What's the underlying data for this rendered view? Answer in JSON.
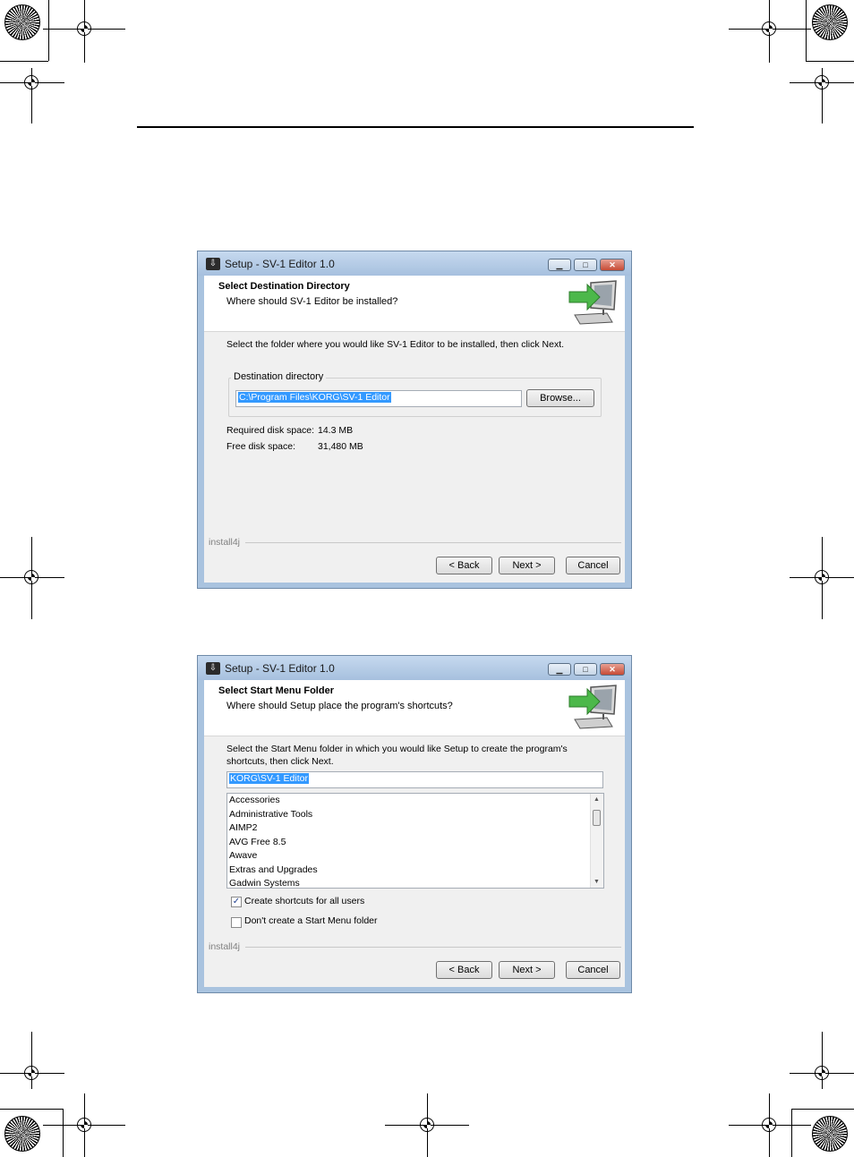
{
  "window1": {
    "title": "Setup - SV-1 Editor 1.0",
    "header_title": "Select Destination Directory",
    "header_subtitle": "Where should SV-1 Editor be installed?",
    "instruction": "Select the folder where you would like SV-1 Editor to be installed, then click Next.",
    "group_label": "Destination directory",
    "path_value": "C:\\Program Files\\KORG\\SV-1 Editor",
    "browse_label": "Browse...",
    "required_label": "Required disk space:",
    "required_value": "14.3 MB",
    "free_label": "Free disk space:",
    "free_value": "31,480 MB",
    "brand": "install4j",
    "back_label": "< Back",
    "next_label": "Next >",
    "cancel_label": "Cancel"
  },
  "window2": {
    "title": "Setup - SV-1 Editor 1.0",
    "header_title": "Select Start Menu Folder",
    "header_subtitle": "Where should Setup place the program's shortcuts?",
    "instruction_line1": "Select the Start Menu folder in which you would like Setup to create the program's",
    "instruction_line2": "shortcuts, then click Next.",
    "folder_value": "KORG\\SV-1 Editor",
    "folders": [
      "Accessories",
      "Administrative Tools",
      "AIMP2",
      "AVG Free 8.5",
      "Awave",
      "Extras and Upgrades",
      "Gadwin Systems"
    ],
    "checkbox_all_users": "Create shortcuts for all users",
    "checkbox_all_users_checked": true,
    "checkbox_no_folder": "Don't create a Start Menu folder",
    "checkbox_no_folder_checked": false,
    "brand": "install4j",
    "back_label": "< Back",
    "next_label": "Next >",
    "cancel_label": "Cancel"
  },
  "icons": {
    "app_icon": "installer-app-icon",
    "header_icon": "monitor-with-arrow-icon",
    "crop_mark": "registration-target-icon",
    "color_bar": "starburst-icon"
  },
  "colors": {
    "titlebar": "#a9c3df",
    "selection": "#3399ff",
    "close_button": "#c64a35",
    "arrow_green": "#4cb84a"
  }
}
